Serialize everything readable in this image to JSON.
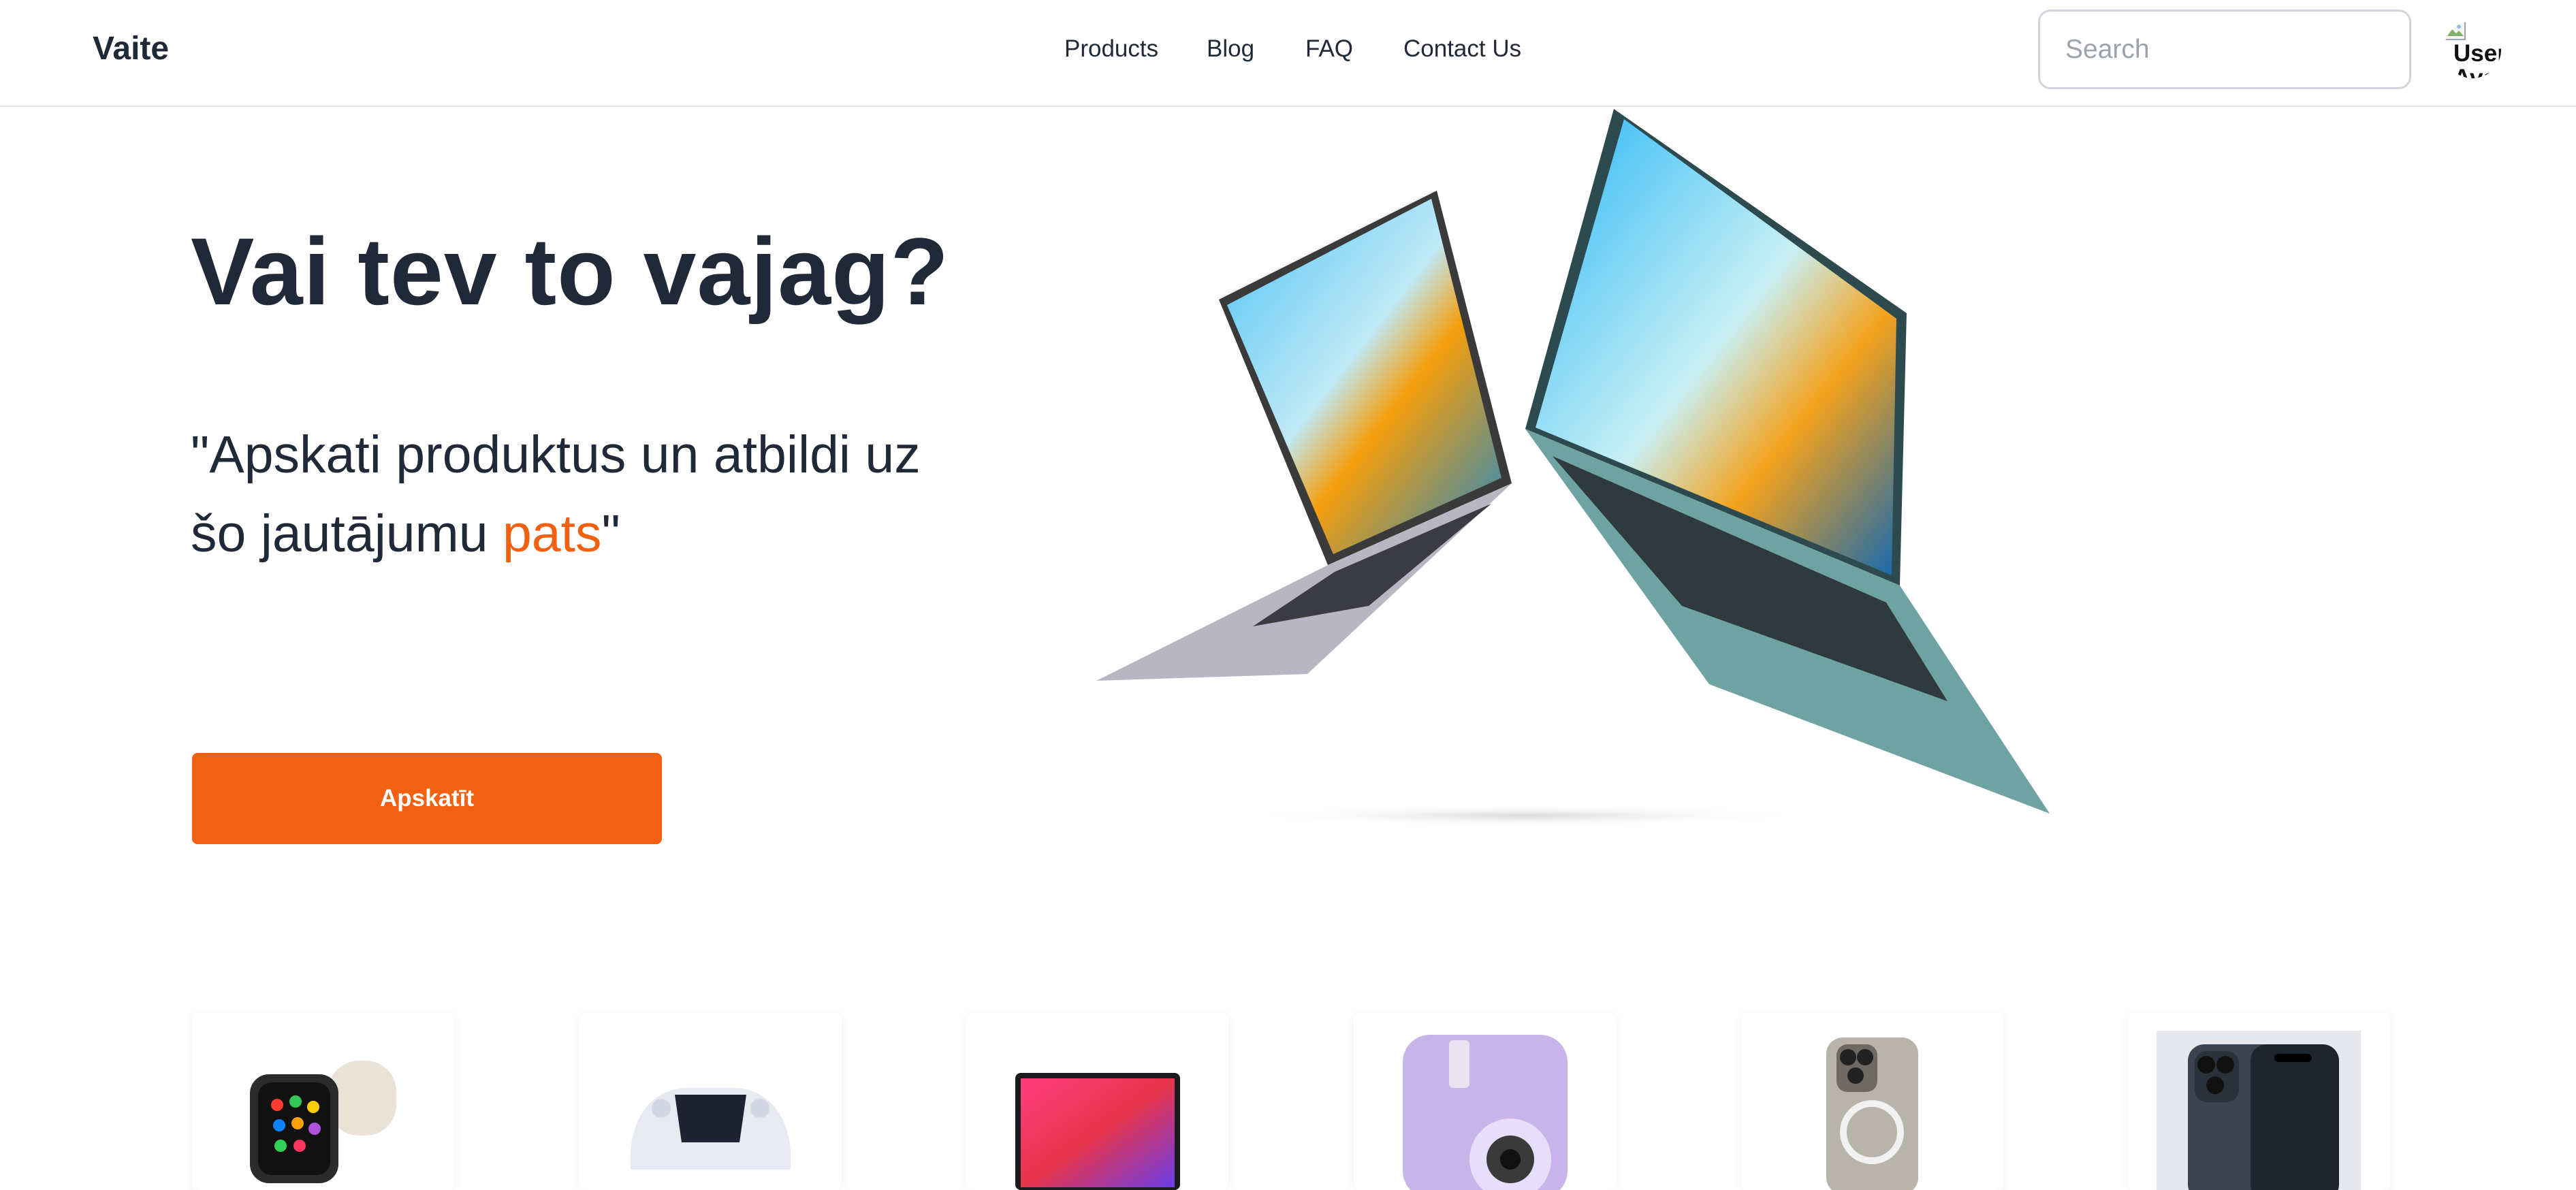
{
  "header": {
    "brand": "Vaite",
    "nav": [
      "Products",
      "Blog",
      "FAQ",
      "Contact Us"
    ],
    "search_placeholder": "Search",
    "avatar_alt": "User Avatar"
  },
  "hero": {
    "title": "Vai tev to vajag?",
    "quote_prefix": "\"Apskati produktus un atbildi uz šo jautājumu ",
    "quote_accent": "pats",
    "quote_suffix": "\"",
    "button_label": "Apskatīt",
    "image": "laptops-image"
  },
  "products": [
    {
      "icon": "smartwatch-image"
    },
    {
      "icon": "game-controller-image"
    },
    {
      "icon": "laptop-image"
    },
    {
      "icon": "instant-camera-image"
    },
    {
      "icon": "smartphone-clear-case-image"
    },
    {
      "icon": "smartphone-image"
    }
  ],
  "colors": {
    "accent": "#f26011",
    "text": "#1f2937",
    "border": "#e5e7eb"
  }
}
